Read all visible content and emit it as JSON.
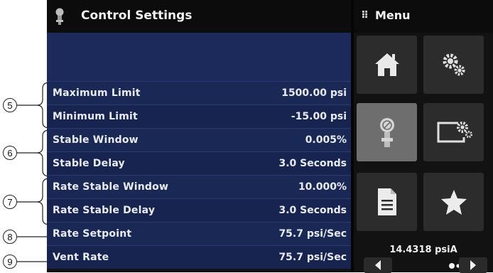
{
  "title": "Control Settings",
  "menu_label": "Menu",
  "rows": [
    {
      "label": "Maximum Limit",
      "value": "1500.00 psi"
    },
    {
      "label": "Minimum Limit",
      "value": "-15.00 psi"
    },
    {
      "label": "Stable Window",
      "value": "0.005%"
    },
    {
      "label": "Stable Delay",
      "value": "3.0 Seconds"
    },
    {
      "label": "Rate Stable Window",
      "value": "10.000%"
    },
    {
      "label": "Rate Stable Delay",
      "value": "3.0 Seconds"
    },
    {
      "label": "Rate Setpoint",
      "value": "75.7 psi/Sec"
    },
    {
      "label": "Vent Rate",
      "value": "75.7 psi/Sec"
    }
  ],
  "callouts": [
    "5",
    "6",
    "7",
    "8",
    "9"
  ],
  "menu_tiles": [
    "home-icon",
    "settings-gears-icon",
    "control-regulator-icon",
    "display-settings-icon",
    "document-icon",
    "favorite-star-icon"
  ],
  "pressure_readout": "14.4318 psiA",
  "colors": {
    "screen_bg": "#121212",
    "row_bg": "#1a2856",
    "tile_bg": "#2c2c2c",
    "tile_active": "#6e6e6e"
  }
}
